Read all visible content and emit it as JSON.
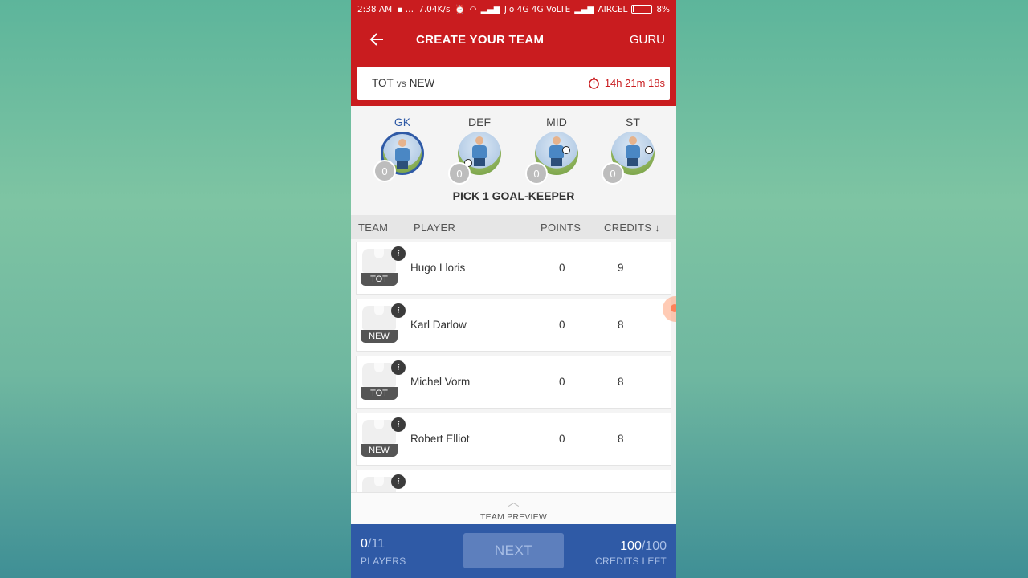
{
  "status_bar": {
    "time": "2:38 AM",
    "speed": "7.04K/s",
    "carrier1": "Jio 4G 4G VoLTE",
    "carrier2": "AIRCEL",
    "battery": "8%"
  },
  "app_bar": {
    "title": "CREATE YOUR TEAM",
    "guru_label": "GURU",
    "back_icon": "arrow-left-icon"
  },
  "match": {
    "team1": "TOT",
    "vs": "vs",
    "team2": "NEW",
    "countdown": "14h 21m 18s",
    "timer_icon": "stopwatch-icon"
  },
  "positions": [
    {
      "label": "GK",
      "count": "0",
      "active": true
    },
    {
      "label": "DEF",
      "count": "0",
      "active": false
    },
    {
      "label": "MID",
      "count": "0",
      "active": false
    },
    {
      "label": "ST",
      "count": "0",
      "active": false
    }
  ],
  "pick_instruction": "PICK 1 GOAL-KEEPER",
  "columns": {
    "team": "TEAM",
    "player": "PLAYER",
    "points": "POINTS",
    "credits": "CREDITS ↓"
  },
  "players": [
    {
      "team": "TOT",
      "name": "Hugo Lloris",
      "points": "0",
      "credits": "9"
    },
    {
      "team": "NEW",
      "name": "Karl Darlow",
      "points": "0",
      "credits": "8"
    },
    {
      "team": "TOT",
      "name": "Michel Vorm",
      "points": "0",
      "credits": "8"
    },
    {
      "team": "NEW",
      "name": "Robert Elliot",
      "points": "0",
      "credits": "8"
    }
  ],
  "team_preview": {
    "label": "TEAM PREVIEW",
    "icon": "chevron-up-icon"
  },
  "footer": {
    "players_selected": "0",
    "players_total": "/11",
    "players_label": "PLAYERS",
    "next_label": "NEXT",
    "credits_left": "100",
    "credits_total": "/100",
    "credits_label": "CREDITS LEFT"
  },
  "colors": {
    "brand_red": "#c91c1f",
    "brand_blue": "#2f5aa6",
    "active_position": "#2f5aa6"
  }
}
